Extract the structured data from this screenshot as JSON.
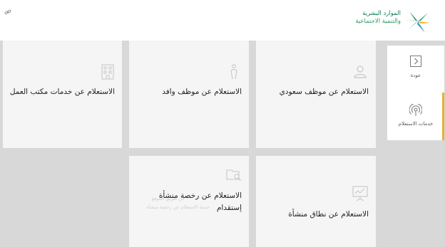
{
  "header": {
    "logo_line1": "الموارد البشرية",
    "logo_line2": "والتنمية الاجتماعية",
    "link_icon": "link-icon"
  },
  "sidebar": {
    "items": [
      {
        "label": "عودة",
        "icon": "chevron-right-box-icon",
        "active": false
      },
      {
        "label": "خدمات الاستعلام",
        "icon": "broadcast-icon",
        "active": true
      }
    ],
    "active_color": "#e8b130"
  },
  "cards": [
    {
      "title": "الاستعلام عن موظف سعودي",
      "icon": "user-icon"
    },
    {
      "title": "الاستعلام عن موظف وافد",
      "icon": "standing-person-icon"
    },
    {
      "title": "الاستعلام عن خدمات مكتب العمل",
      "icon": "building-icon"
    },
    {
      "title": "الاستعلام عن نطاق منشأة",
      "icon": "presentation-chart-icon"
    },
    {
      "title_line1": "الاستعلام عن رخصة منشأة",
      "title_line2": "إستقدام",
      "icon": "folder-search-icon",
      "ghost_line1": "عن طريق الموقع",
      "ghost_line2": "خدمة الاستعلام عن رخصة منشأة"
    }
  ]
}
